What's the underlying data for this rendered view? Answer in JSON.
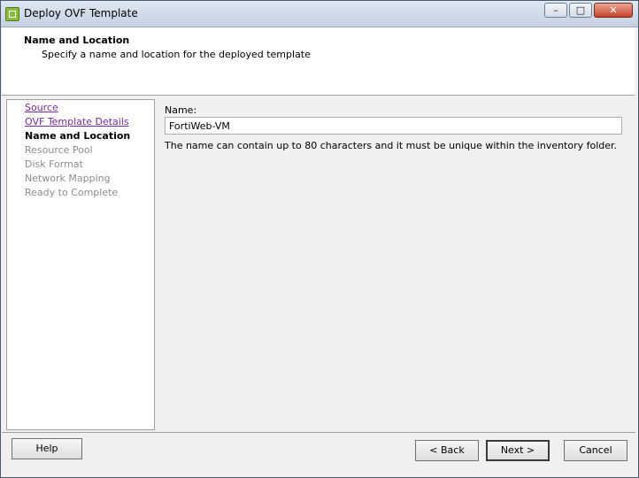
{
  "window": {
    "title": "Deploy OVF Template",
    "icon": "ovf-deploy-icon",
    "controls": {
      "minimize": "–",
      "maximize": "□",
      "close": "✕"
    }
  },
  "header": {
    "title": "Name and Location",
    "subtitle": "Specify a name and location for the deployed template"
  },
  "steps": [
    {
      "label": "Source",
      "state": "completed"
    },
    {
      "label": "OVF Template Details",
      "state": "completed"
    },
    {
      "label": "Name and Location",
      "state": "current"
    },
    {
      "label": "Resource Pool",
      "state": "pending"
    },
    {
      "label": "Disk Format",
      "state": "pending"
    },
    {
      "label": "Network Mapping",
      "state": "pending"
    },
    {
      "label": "Ready to Complete",
      "state": "pending"
    }
  ],
  "form": {
    "name_label": "Name:",
    "name_value": "FortiWeb-VM",
    "hint": "The name can contain up to 80 characters and it must be unique within the inventory folder."
  },
  "buttons": {
    "help": "Help",
    "back": "< Back",
    "next": "Next >",
    "cancel": "Cancel"
  },
  "colors": {
    "link": "#7a2ba0",
    "pending": "#8c8c8c"
  }
}
